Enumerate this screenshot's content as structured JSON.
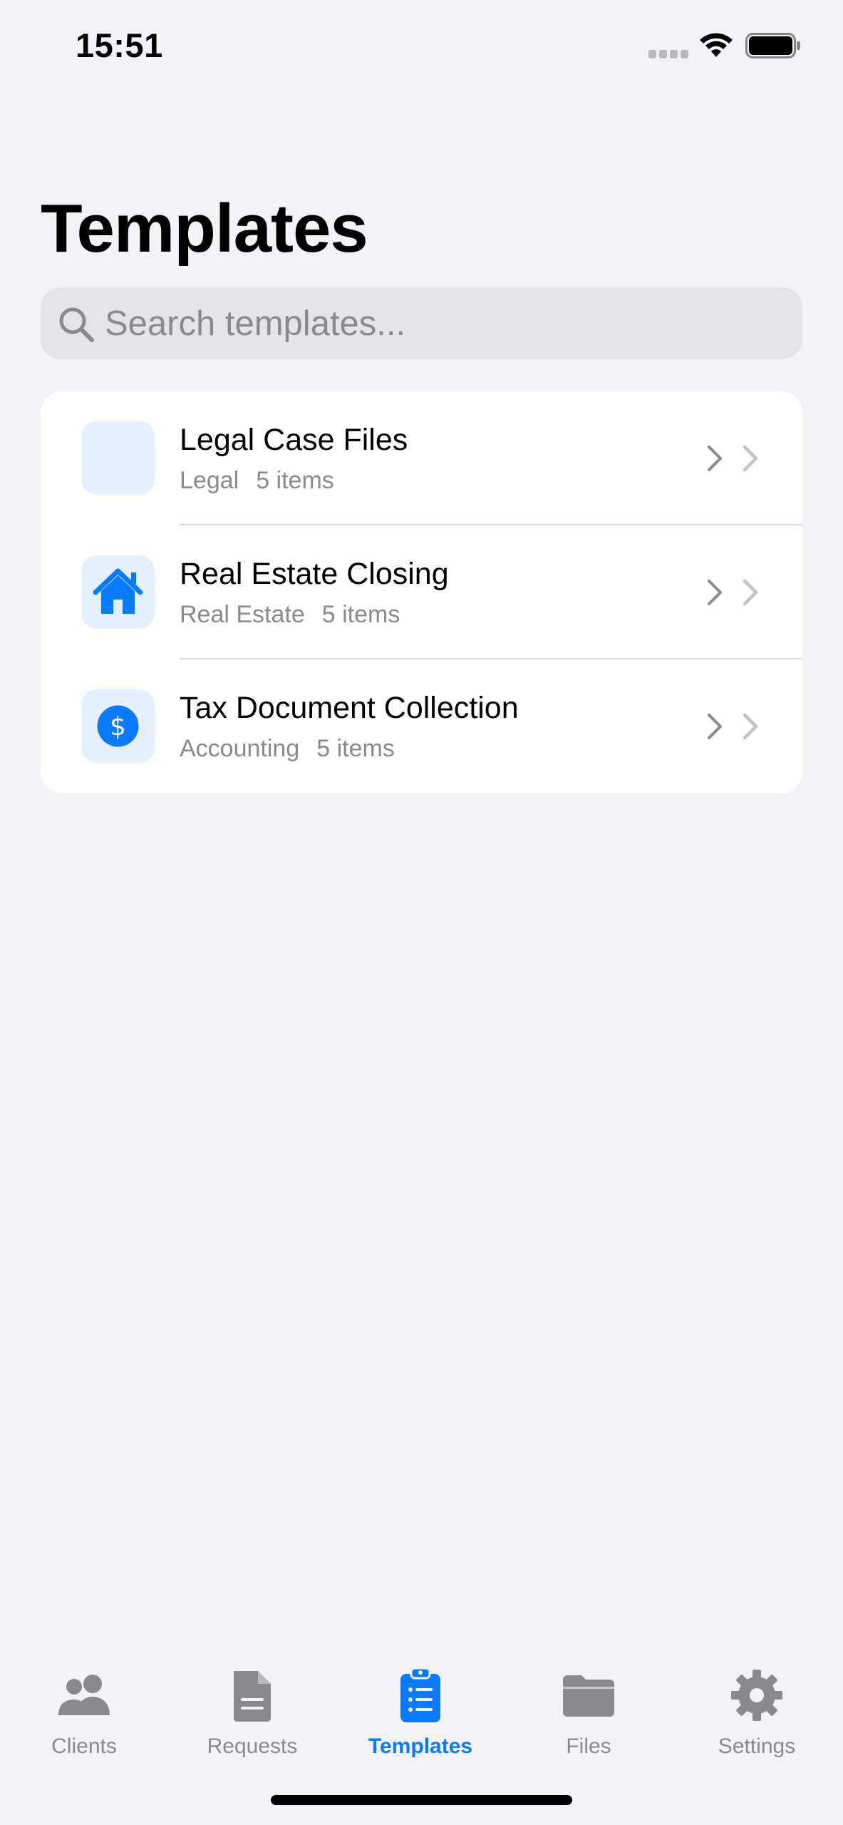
{
  "status_bar": {
    "time": "15:51"
  },
  "page": {
    "title": "Templates"
  },
  "search": {
    "placeholder": "Search templates...",
    "value": ""
  },
  "templates": [
    {
      "title": "Legal Case Files",
      "category": "Legal",
      "count": "5 items",
      "icon": "blank-icon"
    },
    {
      "title": "Real Estate Closing",
      "category": "Real Estate",
      "count": "5 items",
      "icon": "house-icon"
    },
    {
      "title": "Tax Document Collection",
      "category": "Accounting",
      "count": "5 items",
      "icon": "dollar-circle-icon"
    }
  ],
  "tabs": [
    {
      "label": "Clients",
      "icon": "people-icon",
      "active": false
    },
    {
      "label": "Requests",
      "icon": "document-icon",
      "active": false
    },
    {
      "label": "Templates",
      "icon": "clipboard-list-icon",
      "active": true
    },
    {
      "label": "Files",
      "icon": "folder-icon",
      "active": false
    },
    {
      "label": "Settings",
      "icon": "gear-icon",
      "active": false
    }
  ],
  "colors": {
    "accent": "#0a7bff",
    "background": "#f2f2f7",
    "secondary_text": "#8a8a8e",
    "icon_tile": "#e5f0fd"
  }
}
